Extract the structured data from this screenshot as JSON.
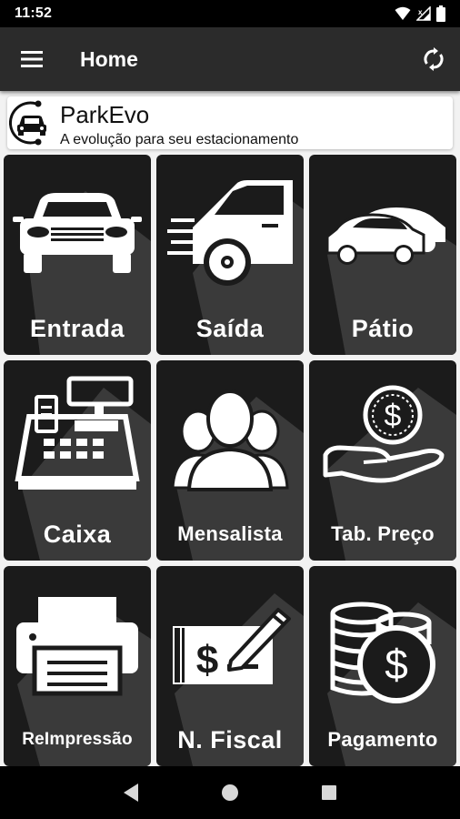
{
  "status_bar": {
    "time": "11:52",
    "icons": [
      "wifi-icon",
      "signal-icon",
      "battery-icon"
    ]
  },
  "app_bar": {
    "title": "Home",
    "menu_icon": "menu-icon",
    "sync_icon": "sync-icon"
  },
  "banner": {
    "app_name": "ParkEvo",
    "tagline": "A evolução para seu estacionamento",
    "logo_icon": "parkevo-logo"
  },
  "tiles": [
    {
      "label": "Entrada",
      "icon": "car-front-icon"
    },
    {
      "label": "Saída",
      "icon": "car-exit-icon"
    },
    {
      "label": "Pátio",
      "icon": "parked-cars-icon"
    },
    {
      "label": "Caixa",
      "icon": "cash-register-icon"
    },
    {
      "label": "Mensalista",
      "icon": "users-group-icon"
    },
    {
      "label": "Tab. Preço",
      "icon": "coin-hand-icon"
    },
    {
      "label": "ReImpressão",
      "icon": "printer-icon"
    },
    {
      "label": "N. Fiscal",
      "icon": "check-pen-icon"
    },
    {
      "label": "Pagamento",
      "icon": "coins-stack-icon"
    }
  ],
  "colors": {
    "tile_bg": "#1b1b1b",
    "tile_shadow": "#3c3c3c",
    "app_bar": "#2b2b2b",
    "label_bar": "#000000"
  },
  "nav_bar": {
    "back_icon": "back-triangle-icon",
    "home_icon": "home-circle-icon",
    "recents_icon": "recents-square-icon"
  }
}
